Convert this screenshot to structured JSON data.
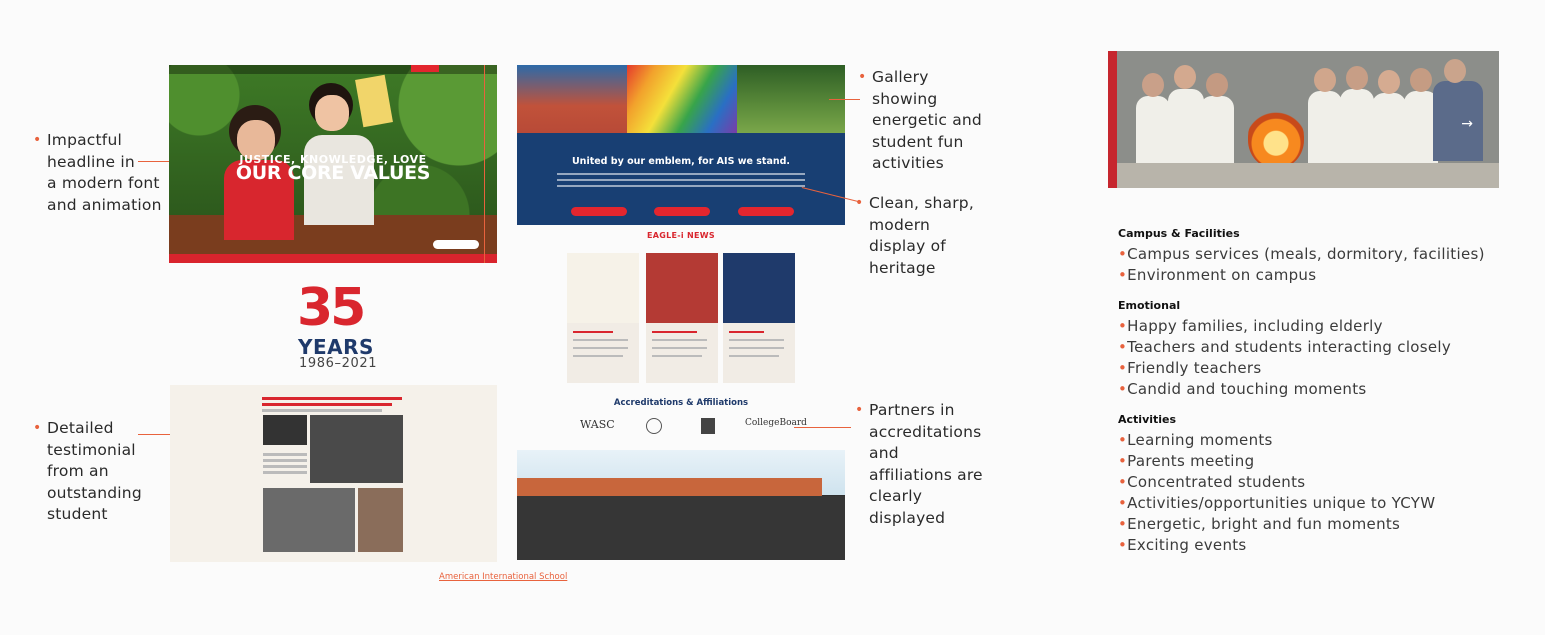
{
  "notes": {
    "headline": [
      "Impactful",
      "headline in",
      "a modern font",
      "and animation"
    ],
    "testimonial": [
      "Detailed",
      "testimonial",
      "from an",
      "outstanding",
      "student"
    ],
    "gallery": [
      "Gallery",
      "showing",
      "energetic and",
      "student fun",
      "activities"
    ],
    "heritage": [
      "Clean, sharp,",
      "modern",
      "display of",
      "heritage"
    ],
    "partners": [
      "Partners in",
      "accreditations",
      "and",
      "affiliations are",
      "clearly",
      "displayed"
    ]
  },
  "hero": {
    "kicker": "JUSTICE, KNOWLEDGE, LOVE",
    "title": "OUR CORE VALUES"
  },
  "anniversary": {
    "number": "35",
    "word": "YEARS",
    "dates": "1986–2021"
  },
  "gallery_page": {
    "headline": "United by our emblem, for AIS we stand.",
    "news_title": "EAGLE-i NEWS",
    "accreditations_title": "Accreditations & Affiliations",
    "logos": [
      "WASC",
      "CollegeBoard"
    ]
  },
  "themes": [
    {
      "heading": "Campus & Facilities",
      "items": [
        "Campus services (meals, dormitory, facilities)",
        "Environment on campus"
      ]
    },
    {
      "heading": "Emotional",
      "items": [
        "Happy families, including elderly",
        "Teachers and students interacting closely",
        "Friendly teachers",
        "Candid and touching moments"
      ]
    },
    {
      "heading": "Activities",
      "items": [
        "Learning moments",
        "Parents meeting",
        "Concentrated students",
        "Activities/opportunities unique to YCYW",
        "Energetic, bright and fun moments",
        "Exciting events"
      ]
    }
  ],
  "source_link": "American International School",
  "colors": {
    "accent": "#e8623d",
    "brand_red": "#d9262e",
    "brand_navy": "#1f3a6b"
  }
}
